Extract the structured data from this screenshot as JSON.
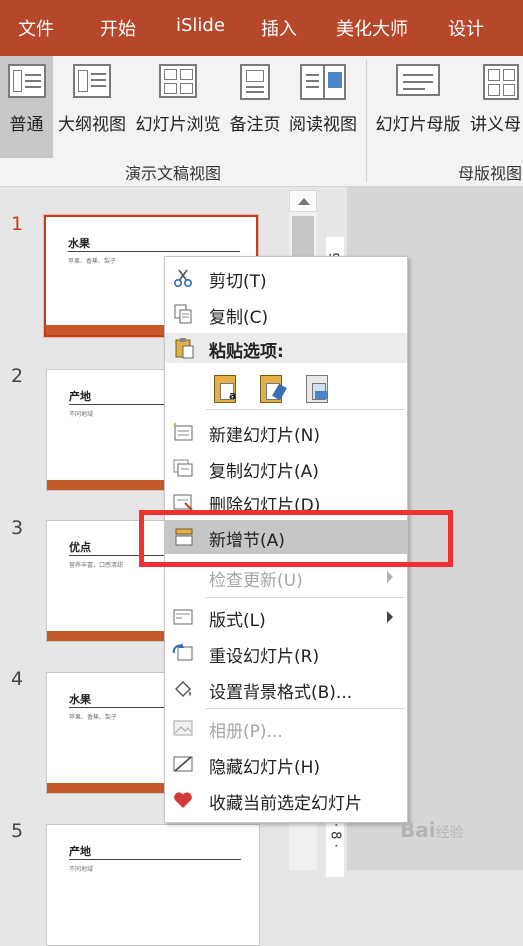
{
  "tabs": [
    "文件",
    "开始",
    "iSlide",
    "插入",
    "美化大师",
    "设计"
  ],
  "ribbon": {
    "buttons": [
      "普通",
      "大纲视图",
      "幻灯片浏览",
      "备注页",
      "阅读视图",
      "幻灯片母版",
      "讲义母"
    ],
    "groups": [
      "演示文稿视图",
      "母版视图"
    ]
  },
  "slides": [
    {
      "num": "1",
      "title": "水果",
      "sub": "苹果、香蕉、梨子"
    },
    {
      "num": "2",
      "title": "产地",
      "sub": "不同地域"
    },
    {
      "num": "3",
      "title": "优点",
      "sub": "营养丰富，口感清甜"
    },
    {
      "num": "4",
      "title": "水果",
      "sub": "苹果、香蕉、梨子"
    },
    {
      "num": "5",
      "title": "产地",
      "sub": "不同地域"
    }
  ],
  "ruler": {
    "top": "9",
    "bottom": "9 · 8 ·"
  },
  "menu": {
    "cut": "剪切(T)",
    "copy": "复制(C)",
    "paste_options": "粘贴选项:",
    "new_slide": "新建幻灯片(N)",
    "duplicate_slide": "复制幻灯片(A)",
    "delete_slide": "删除幻灯片(D)",
    "add_section": "新增节(A)",
    "check_updates": "检查更新(U)",
    "layout": "版式(L)",
    "reset_slide": "重设幻灯片(R)",
    "format_background": "设置背景格式(B)...",
    "photo_album": "相册(P)...",
    "hide_slide": "隐藏幻灯片(H)",
    "favorite_slide": "收藏当前选定幻灯片"
  },
  "colors": {
    "accent": "#b7472a",
    "highlight_box": "#ee3232"
  },
  "watermark": {
    "main": "Bai",
    "suffix": "经验"
  }
}
